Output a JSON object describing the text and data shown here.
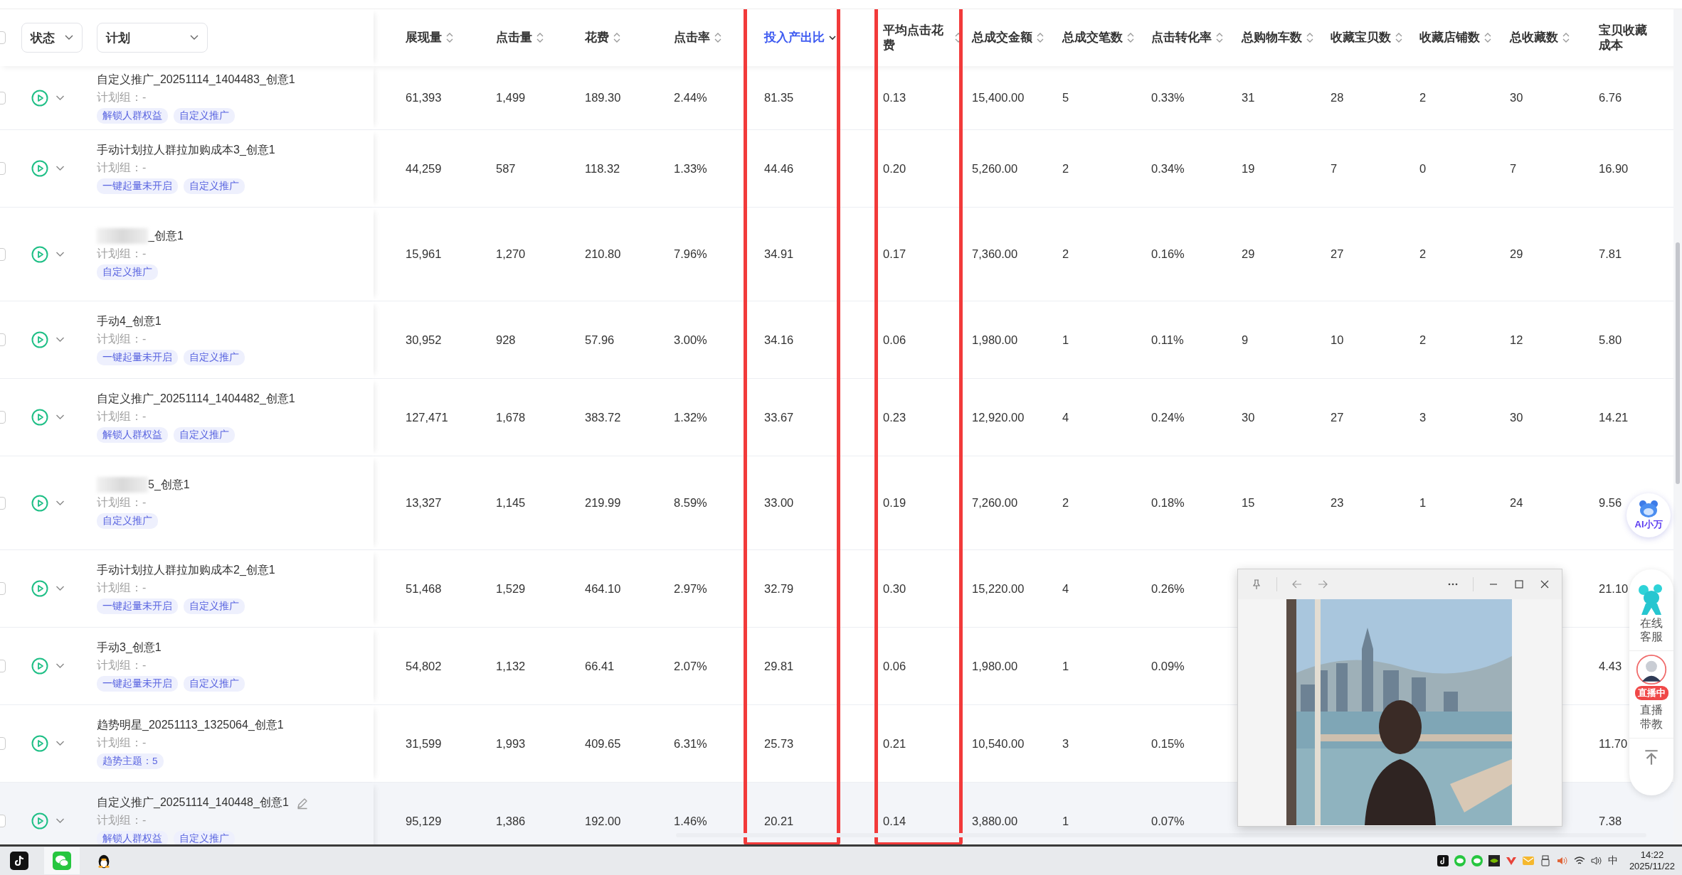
{
  "select_all": {
    "checked": false
  },
  "filters": [
    {
      "label": "状态"
    },
    {
      "label": "计划"
    }
  ],
  "columns": [
    {
      "label": "展现量",
      "sorted": false,
      "outlined": false
    },
    {
      "label": "点击量",
      "sorted": false,
      "outlined": false
    },
    {
      "label": "花费",
      "sorted": false,
      "outlined": false
    },
    {
      "label": "点击率",
      "sorted": false,
      "outlined": false
    },
    {
      "label": "投入产出比",
      "sorted": true,
      "outlined": true
    },
    {
      "label": "平均点击花费",
      "sorted": false,
      "outlined": true
    },
    {
      "label": "总成交金额",
      "sorted": false,
      "outlined": false
    },
    {
      "label": "总成交笔数",
      "sorted": false,
      "outlined": false
    },
    {
      "label": "点击转化率",
      "sorted": false,
      "outlined": false
    },
    {
      "label": "总购物车数",
      "sorted": false,
      "outlined": false
    },
    {
      "label": "收藏宝贝数",
      "sorted": false,
      "outlined": false
    },
    {
      "label": "收藏店铺数",
      "sorted": false,
      "outlined": false
    },
    {
      "label": "总收藏数",
      "sorted": false,
      "outlined": false
    },
    {
      "label": "宝贝收藏成本",
      "outlined": false
    }
  ],
  "rows": [
    {
      "checked": false,
      "name": "自定义推广_20251114_1404483_创意1",
      "redacted": false,
      "hovered": false,
      "group": "计划组：-",
      "tags": [
        "解锁人群权益",
        "自定义推广"
      ],
      "cells": [
        "61,393",
        "1,499",
        "189.30",
        "2.44%",
        "81.35",
        "0.13",
        "15,400.00",
        "5",
        "0.33%",
        "31",
        "28",
        "2",
        "30",
        "6.76"
      ]
    },
    {
      "checked": false,
      "name": "手动计划拉人群拉加购成本3_创意1",
      "redacted": false,
      "hovered": false,
      "group": "计划组：-",
      "tags": [
        "一键起量未开启",
        "自定义推广"
      ],
      "cells": [
        "44,259",
        "587",
        "118.32",
        "1.33%",
        "44.46",
        "0.20",
        "5,260.00",
        "2",
        "0.34%",
        "19",
        "7",
        "0",
        "7",
        "16.90"
      ]
    },
    {
      "checked": false,
      "name": "_创意1",
      "redacted": true,
      "hovered": false,
      "group": "计划组：-",
      "tags": [
        "自定义推广"
      ],
      "cells": [
        "15,961",
        "1,270",
        "210.80",
        "7.96%",
        "34.91",
        "0.17",
        "7,360.00",
        "2",
        "0.16%",
        "29",
        "27",
        "2",
        "29",
        "7.81"
      ]
    },
    {
      "checked": false,
      "name": "手动4_创意1",
      "redacted": false,
      "hovered": false,
      "group": "计划组：-",
      "tags": [
        "一键起量未开启",
        "自定义推广"
      ],
      "cells": [
        "30,952",
        "928",
        "57.96",
        "3.00%",
        "34.16",
        "0.06",
        "1,980.00",
        "1",
        "0.11%",
        "9",
        "10",
        "2",
        "12",
        "5.80"
      ]
    },
    {
      "checked": false,
      "name": "自定义推广_20251114_1404482_创意1",
      "redacted": false,
      "hovered": false,
      "group": "计划组：-",
      "tags": [
        "解锁人群权益",
        "自定义推广"
      ],
      "cells": [
        "127,471",
        "1,678",
        "383.72",
        "1.32%",
        "33.67",
        "0.23",
        "12,920.00",
        "4",
        "0.24%",
        "30",
        "27",
        "3",
        "30",
        "14.21"
      ]
    },
    {
      "checked": false,
      "name": "5_创意1",
      "redacted": true,
      "hovered": false,
      "group": "计划组：-",
      "tags": [
        "自定义推广"
      ],
      "cells": [
        "13,327",
        "1,145",
        "219.99",
        "8.59%",
        "33.00",
        "0.19",
        "7,260.00",
        "2",
        "0.18%",
        "15",
        "23",
        "1",
        "24",
        "9.56"
      ]
    },
    {
      "checked": false,
      "name": "手动计划拉人群拉加购成本2_创意1",
      "redacted": false,
      "hovered": false,
      "group": "计划组：-",
      "tags": [
        "一键起量未开启",
        "自定义推广"
      ],
      "cells": [
        "51,468",
        "1,529",
        "464.10",
        "2.97%",
        "32.79",
        "0.30",
        "15,220.00",
        "4",
        "0.26%",
        null,
        null,
        null,
        null,
        "21.10"
      ]
    },
    {
      "checked": false,
      "name": "手动3_创意1",
      "redacted": false,
      "hovered": false,
      "group": "计划组：-",
      "tags": [
        "一键起量未开启",
        "自定义推广"
      ],
      "cells": [
        "54,802",
        "1,132",
        "66.41",
        "2.07%",
        "29.81",
        "0.06",
        "1,980.00",
        "1",
        "0.09%",
        null,
        null,
        null,
        null,
        "4.43"
      ]
    },
    {
      "checked": false,
      "name": "趋势明星_20251113_1325064_创意1",
      "redacted": false,
      "hovered": false,
      "group": "计划组：-",
      "tags": [
        "趋势主题：5"
      ],
      "cells": [
        "31,599",
        "1,993",
        "409.65",
        "6.31%",
        "25.73",
        "0.21",
        "10,540.00",
        "3",
        "0.15%",
        null,
        null,
        null,
        null,
        "11.70"
      ]
    },
    {
      "checked": false,
      "name": "自定义推广_20251114_140448_创意1",
      "redacted": false,
      "hovered": true,
      "group": "计划组：-",
      "tags": [
        "解锁人群权益",
        "自定义推广"
      ],
      "cells": [
        "95,129",
        "1,386",
        "192.00",
        "1.46%",
        "20.21",
        "0.14",
        "3,880.00",
        "1",
        "0.07%",
        null,
        null,
        null,
        null,
        "7.38"
      ]
    }
  ],
  "side_widget": {
    "assistant": "AI小万",
    "service": "在线客服",
    "live_badge": "直播中",
    "live": "直播带教"
  },
  "taskbar": {
    "ime": "中",
    "time": "14:22",
    "date": "2025/11/22"
  }
}
